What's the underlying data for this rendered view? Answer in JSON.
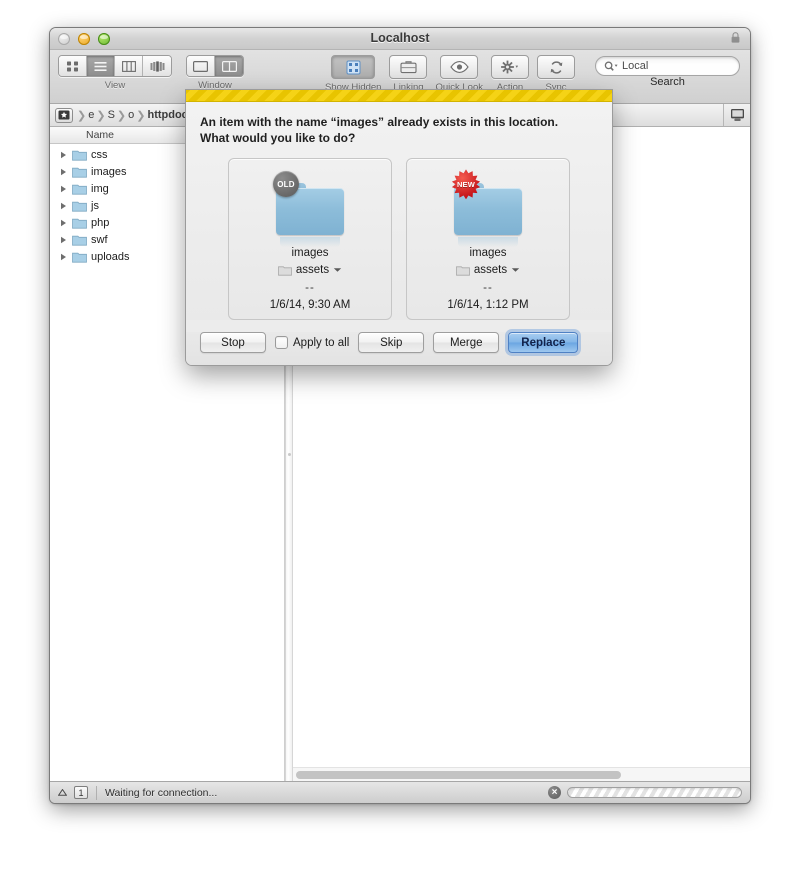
{
  "window": {
    "title": "Localhost",
    "traffic": {
      "close": "close-button",
      "minimize": "minimize-button",
      "zoom": "zoom-button"
    },
    "lock": "lock-icon"
  },
  "toolbar": {
    "groups": [
      {
        "label": "View",
        "segments": [
          "icon-view",
          "list-view",
          "column-view",
          "coverflow-view"
        ],
        "active": 1
      },
      {
        "label": "Window",
        "segments": [
          "single-pane",
          "split-pane"
        ],
        "active": 1
      }
    ],
    "buttons": [
      {
        "label": "Show Hidden",
        "icon": "show-hidden-icon",
        "pressed": true
      },
      {
        "label": "Linking",
        "icon": "briefcase-icon",
        "pressed": false
      },
      {
        "label": "Quick Look",
        "icon": "eye-icon",
        "pressed": false
      },
      {
        "label": "Action",
        "icon": "gear-icon",
        "pressed": false
      },
      {
        "label": "Sync",
        "icon": "sync-icon",
        "pressed": false
      }
    ],
    "search": {
      "value": "Local",
      "placeholder": "Search",
      "label": "Search"
    }
  },
  "pathbar": {
    "crumbs": [
      "e",
      "S",
      "o",
      "httpdocs"
    ],
    "computer_button": "computer-icon"
  },
  "filelist": {
    "column_header": "Name",
    "rows": [
      {
        "name": "css"
      },
      {
        "name": "images"
      },
      {
        "name": "img"
      },
      {
        "name": "js"
      },
      {
        "name": "php"
      },
      {
        "name": "swf"
      },
      {
        "name": "uploads"
      }
    ]
  },
  "statusbar": {
    "count": "1",
    "message": "Waiting for connection...",
    "stop_label": "×"
  },
  "dialog": {
    "message": "An item with the name “images” already exists in this location. What would you like to do?",
    "cards": [
      {
        "badge": "OLD",
        "badge_kind": "old",
        "name": "images",
        "location": "assets",
        "size": "--",
        "date": "1/6/14, 9:30 AM"
      },
      {
        "badge": "NEW",
        "badge_kind": "new",
        "name": "images",
        "location": "assets",
        "size": "--",
        "date": "1/6/14, 1:12 PM"
      }
    ],
    "buttons": {
      "stop": "Stop",
      "apply_to_all": "Apply to all",
      "skip": "Skip",
      "merge": "Merge",
      "replace": "Replace"
    },
    "apply_to_all_checked": false,
    "accent_color": "#83b6e8",
    "stripe_color": "#f5d316"
  }
}
